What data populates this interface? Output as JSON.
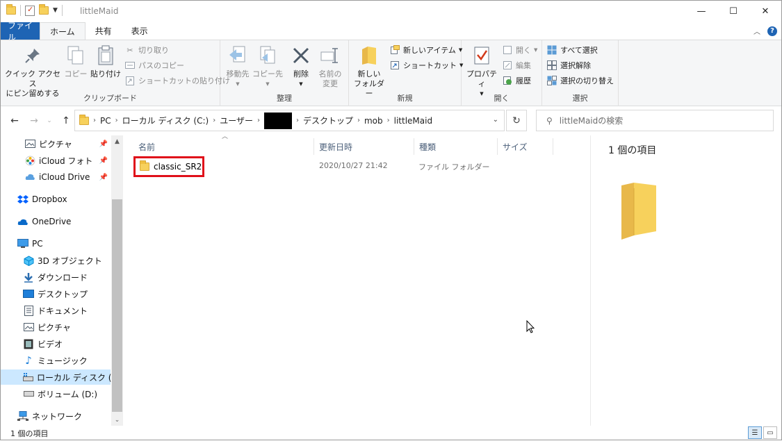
{
  "window": {
    "title": "littleMaid",
    "buttons": {
      "minimize": "—",
      "maximize": "☐",
      "close": "✕"
    }
  },
  "ribbon_tabs": [
    "ファイル",
    "ホーム",
    "共有",
    "表示"
  ],
  "ribbon": {
    "clipboard": {
      "label": "クリップボード",
      "pin_quick_access": "クイック アクセス\nにピン留めする",
      "copy": "コピー",
      "paste": "貼り付け",
      "cut": "切り取り",
      "copy_path": "パスのコピー",
      "paste_shortcut": "ショートカットの貼り付け"
    },
    "organize": {
      "label": "整理",
      "move_to": "移動先",
      "copy_to": "コピー先",
      "delete": "削除",
      "rename": "名前の\n変更"
    },
    "new": {
      "label": "新規",
      "new_folder": "新しい\nフォルダー",
      "new_item": "新しいアイテム",
      "shortcut": "ショートカット"
    },
    "open": {
      "label": "開く",
      "properties": "プロパティ",
      "open": "開く",
      "edit": "編集",
      "history": "履歴"
    },
    "select": {
      "label": "選択",
      "select_all": "すべて選択",
      "select_none": "選択解除",
      "invert": "選択の切り替え"
    }
  },
  "address": {
    "crumbs": [
      "PC",
      "ローカル ディスク (C:)",
      "ユーザー",
      "デスクトップ",
      "mob",
      "littleMaid"
    ]
  },
  "search": {
    "placeholder": "littleMaidの検索"
  },
  "nav": {
    "items": [
      {
        "label": "ピクチャ",
        "icon": "pictures-icon",
        "pinned": true
      },
      {
        "label": "iCloud フォト",
        "icon": "icloud-photos-icon",
        "pinned": true
      },
      {
        "label": "iCloud Drive",
        "icon": "icloud-drive-icon",
        "pinned": true
      },
      {
        "label": "Dropbox",
        "icon": "dropbox-icon"
      },
      {
        "label": "OneDrive",
        "icon": "onedrive-icon"
      },
      {
        "label": "PC",
        "icon": "pc-icon"
      },
      {
        "label": "3D オブジェクト",
        "icon": "3d-objects-icon"
      },
      {
        "label": "ダウンロード",
        "icon": "downloads-icon"
      },
      {
        "label": "デスクトップ",
        "icon": "desktop-icon"
      },
      {
        "label": "ドキュメント",
        "icon": "documents-icon"
      },
      {
        "label": "ピクチャ",
        "icon": "pictures-icon"
      },
      {
        "label": "ビデオ",
        "icon": "videos-icon"
      },
      {
        "label": "ミュージック",
        "icon": "music-icon"
      },
      {
        "label": "ローカル ディスク (C:)",
        "icon": "local-disk-icon",
        "selected": true
      },
      {
        "label": "ボリューム (D:)",
        "icon": "volume-icon"
      },
      {
        "label": "ネットワーク",
        "icon": "network-icon"
      }
    ]
  },
  "columns": {
    "name": "名前",
    "modified": "更新日時",
    "type": "種類",
    "size": "サイズ"
  },
  "files": [
    {
      "name": "classic_SR2",
      "modified": "2020/10/27 21:42",
      "type": "ファイル フォルダー",
      "size": ""
    }
  ],
  "preview": {
    "count": "1 個の項目"
  },
  "status": {
    "count": "1 個の項目"
  },
  "colors": {
    "accent": "#1e64b4",
    "highlight_box": "#e0101a",
    "selected_nav": "#cce8ff"
  }
}
